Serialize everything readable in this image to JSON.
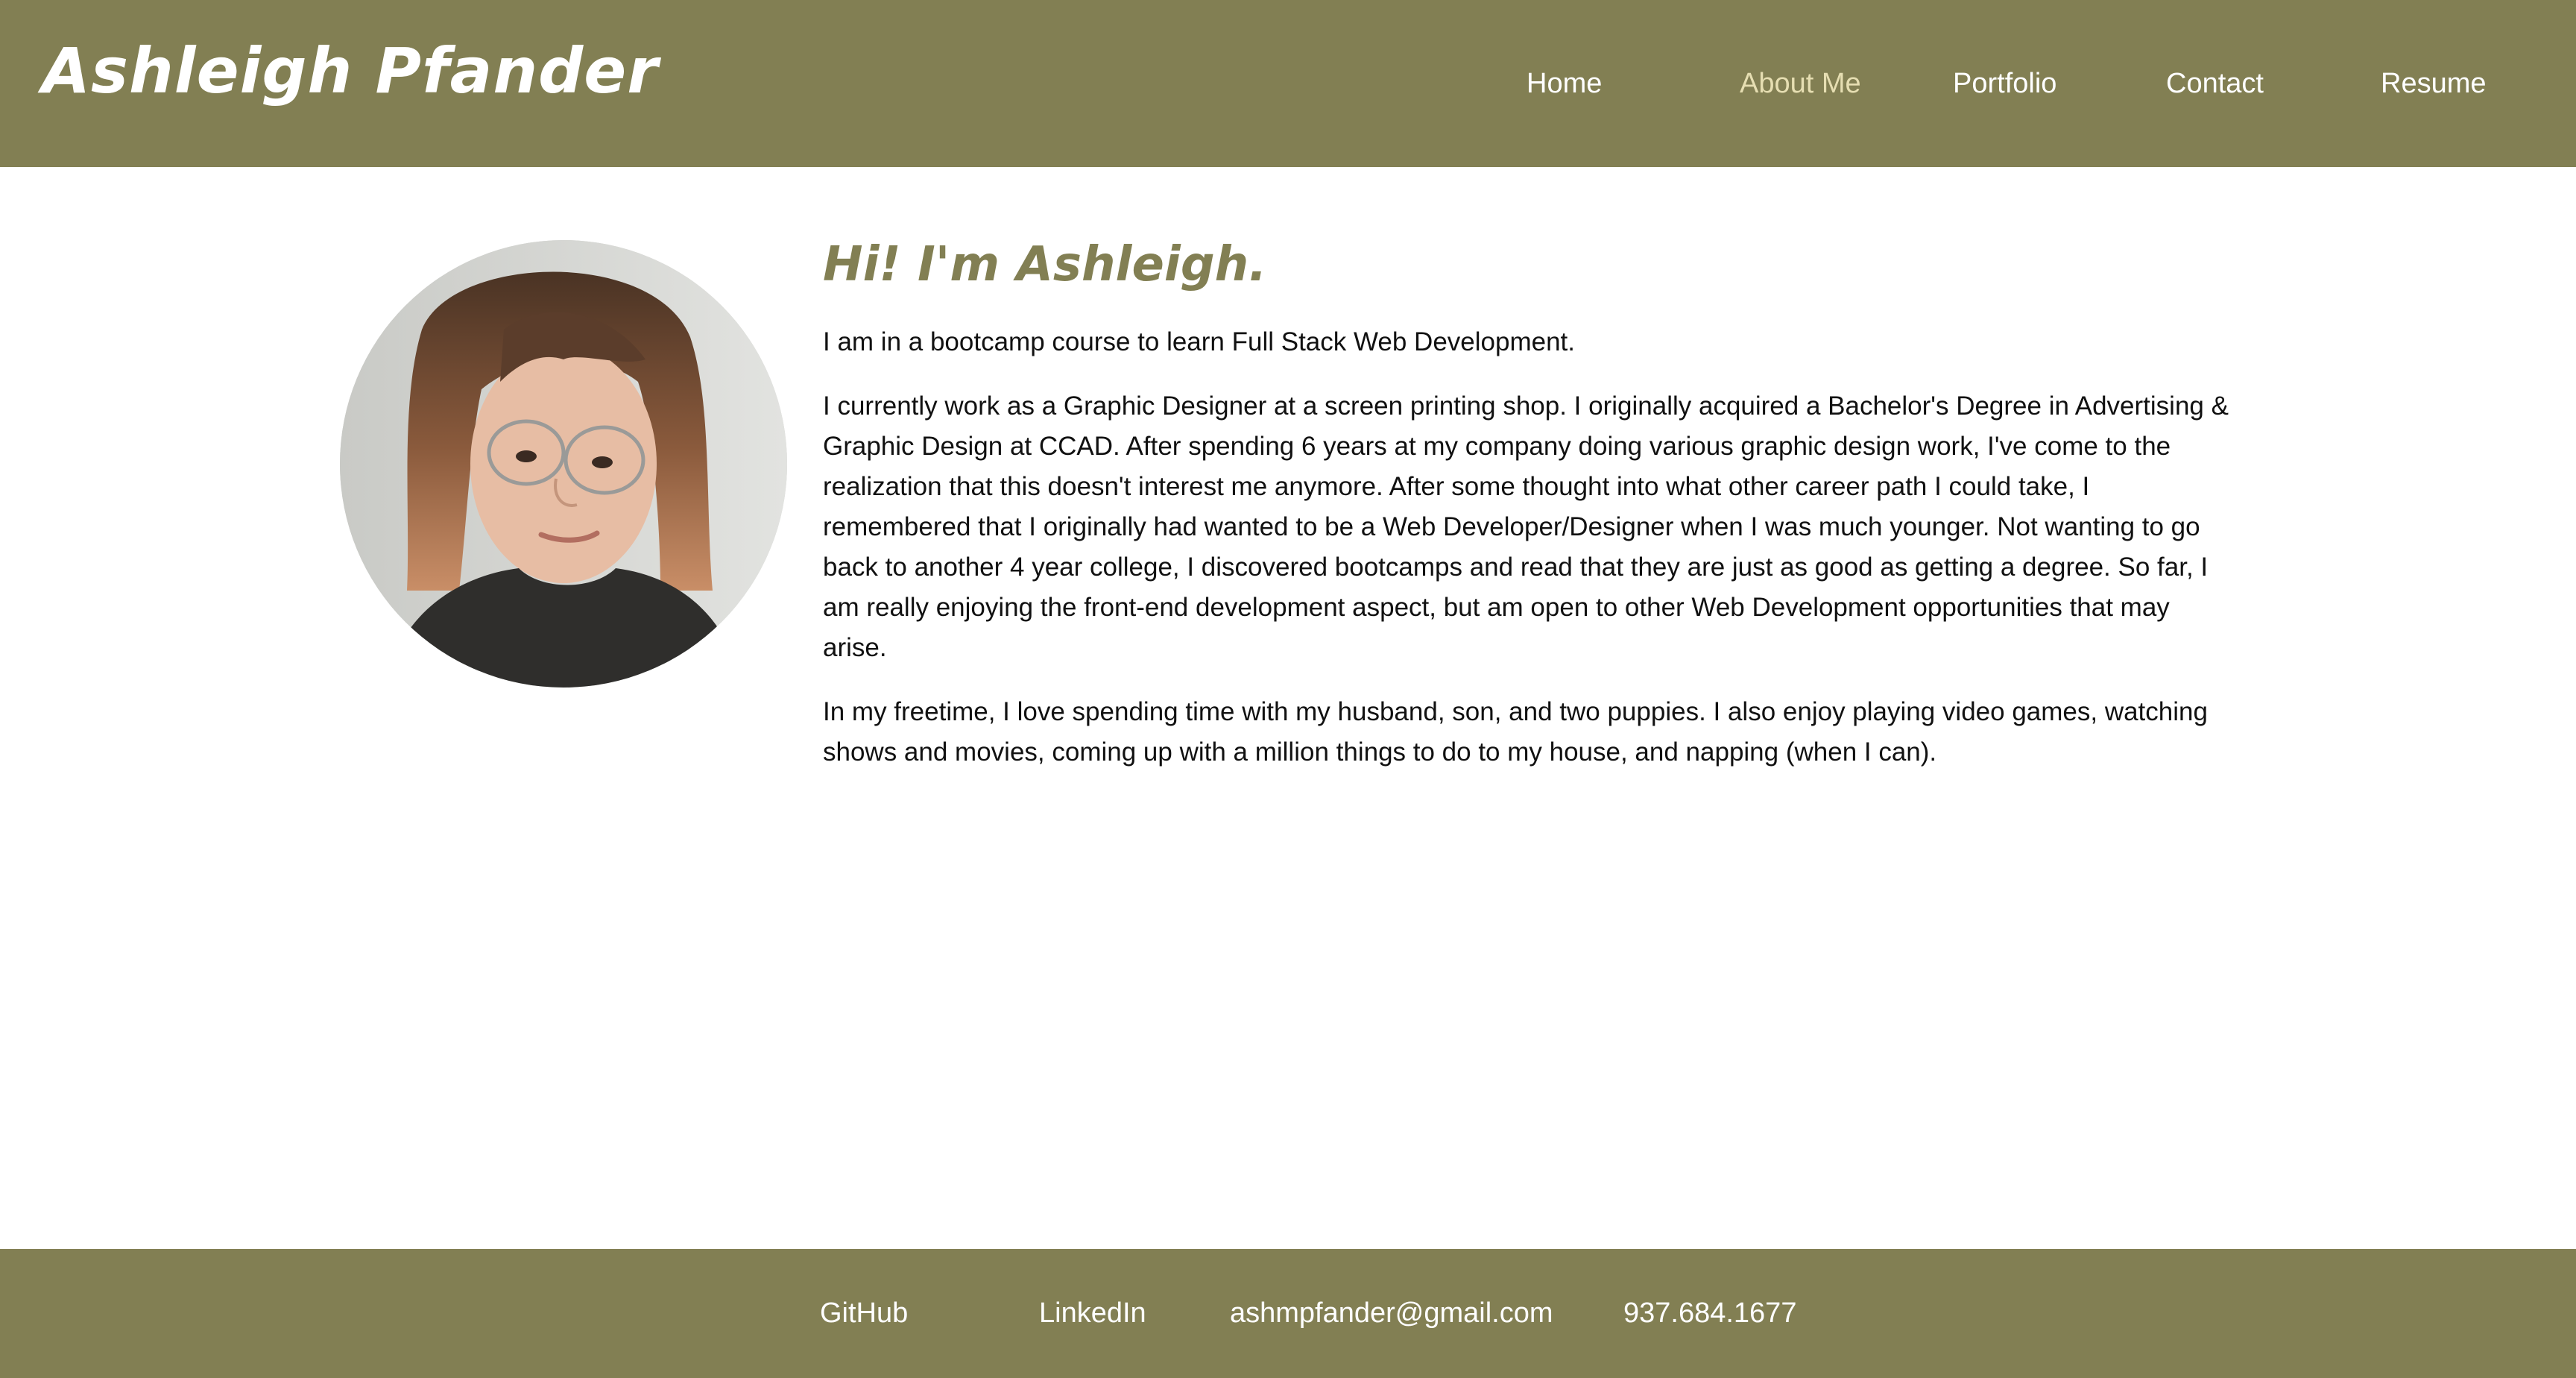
{
  "header": {
    "brand": "Ashleigh Pfander",
    "nav": [
      {
        "label": "Home"
      },
      {
        "label": "About Me",
        "active": true
      },
      {
        "label": "Portfolio"
      },
      {
        "label": "Contact"
      },
      {
        "label": "Resume"
      }
    ]
  },
  "main": {
    "avatar_icon": "profile-photo",
    "heading": "Hi! I'm Ashleigh.",
    "paragraphs": [
      "I am in a bootcamp course to learn Full Stack Web Development.",
      "I currently work as a Graphic Designer at a screen printing shop. I originally acquired a Bachelor's Degree in Advertising & Graphic Design at CCAD. After spending 6 years at my company doing various graphic design work, I've come to the realization that this doesn't interest me anymore. After some thought into what other career path I could take, I remembered that I originally had wanted to be a Web Developer/Designer when I was much younger. Not wanting to go back to another 4 year college, I discovered bootcamps and read that they are just as good as getting a degree. So far, I am really enjoying the front-end development aspect, but am open to other Web Development opportunities that may arise.",
      "In my freetime, I love spending time with my husband, son, and two puppies. I also enjoy playing video games, watching shows and movies, coming up with a million things to do to my house, and napping (when I can)."
    ]
  },
  "footer": {
    "github": "GitHub",
    "linkedin": "LinkedIn",
    "email": "ashmpfander@gmail.com",
    "phone": "937.684.1677"
  },
  "colors": {
    "brand_olive": "#827f53",
    "nav_active": "#e6deb2",
    "text": "#111111"
  }
}
